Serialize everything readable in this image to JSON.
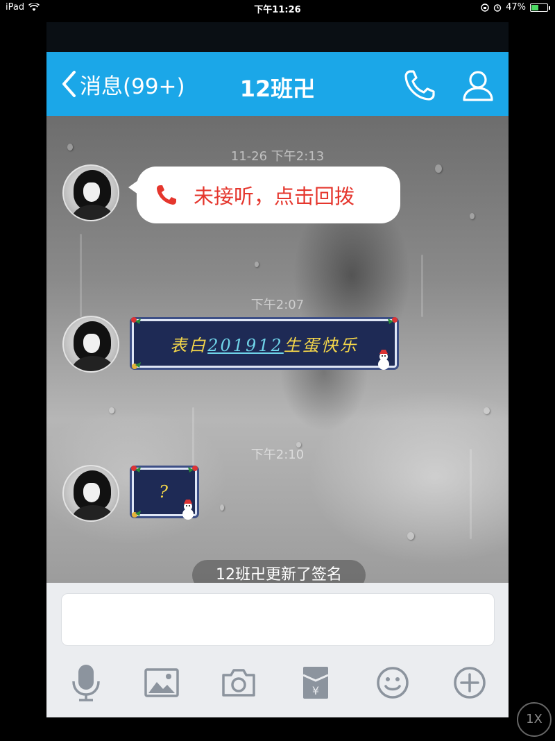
{
  "status_bar": {
    "device": "iPad",
    "time": "下午11:26",
    "battery_percent": "47%",
    "battery_level": 0.47
  },
  "nav": {
    "back_label": "消息(99+)",
    "title": "12班卍"
  },
  "messages": {
    "timestamp_1": "11-26 下午2:13",
    "missed_call_text": "未接听，点击回拨",
    "timestamp_2": "下午2:07",
    "deco_prefix": "表白",
    "deco_link": "201912",
    "deco_suffix": "生蛋快乐",
    "timestamp_3": "下午2:10",
    "question_text": "?",
    "notice_text": "12班卍更新了签名"
  },
  "input": {
    "value": "",
    "placeholder": ""
  },
  "toolbar": {
    "icons": [
      "microphone-icon",
      "picture-icon",
      "camera-icon",
      "red-envelope-icon",
      "emoji-icon",
      "plus-icon"
    ]
  },
  "zoom_label": "1X",
  "colors": {
    "nav_blue": "#1ba7e8",
    "missed_call_red": "#e5362d",
    "deco_yellow": "#f4d64a",
    "deco_link": "#6fd3e8"
  }
}
